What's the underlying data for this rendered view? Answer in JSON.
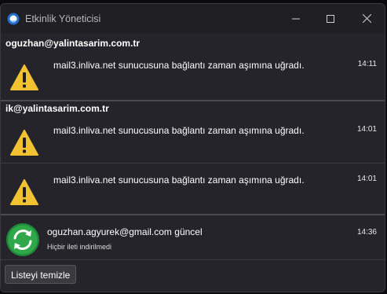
{
  "window": {
    "title": "Etkinlik Yöneticisi"
  },
  "accounts": [
    {
      "name": "oguzhan@yalintasarim.com.tr",
      "events": [
        {
          "message": "mail3.inliva.net sunucusuna bağlantı zaman aşımına uğradı.",
          "time": "14:11",
          "icon": "warning-icon"
        }
      ]
    },
    {
      "name": "ik@yalintasarim.com.tr",
      "events": [
        {
          "message": "mail3.inliva.net sunucusuna bağlantı zaman aşımına uğradı.",
          "time": "14:01",
          "icon": "warning-icon"
        },
        {
          "message": "mail3.inliva.net sunucusuna bağlantı zaman aşımına uğradı.",
          "time": "14:01",
          "icon": "warning-icon"
        }
      ]
    }
  ],
  "sync_event": {
    "message": "oguzhan.agyurek@gmail.com güncel",
    "sub": "Hiçbir ileti indirilmedi",
    "time": "14:36",
    "icon": "sync-icon"
  },
  "footer": {
    "clear_label": "Listeyi temizle"
  },
  "colors": {
    "warning": "#f2c230",
    "sync_green": "#2fa84a",
    "background": "#25242a"
  }
}
